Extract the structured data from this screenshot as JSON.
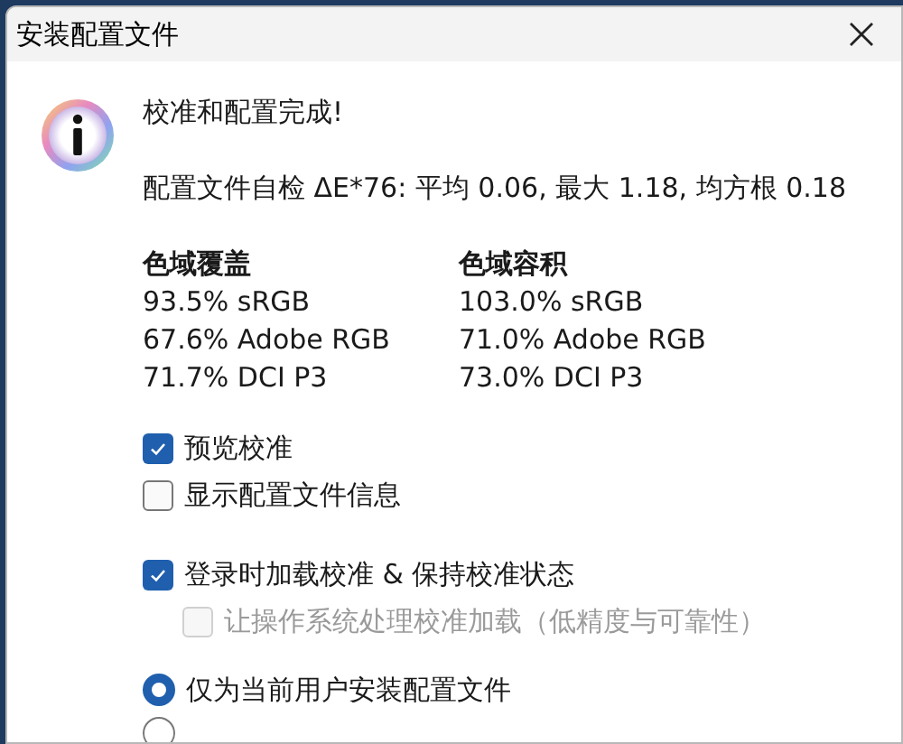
{
  "window": {
    "title": "安装配置文件"
  },
  "message": {
    "heading": "校准和配置完成!",
    "self_check": "配置文件自检 ΔE*76: 平均 0.06, 最大 1.18, 均方根 0.18"
  },
  "gamut": [
    {
      "title": "色域覆盖",
      "values": [
        "93.5% sRGB",
        "67.6% Adobe RGB",
        "71.7% DCI P3"
      ]
    },
    {
      "title": "色域容积",
      "values": [
        "103.0% sRGB",
        "71.0% Adobe RGB",
        "73.0% DCI P3"
      ]
    }
  ],
  "options": [
    {
      "label": "预览校准",
      "checked": true,
      "disabled": false
    },
    {
      "label": "显示配置文件信息",
      "checked": false,
      "disabled": false
    },
    {
      "label": "登录时加载校准 & 保持校准状态",
      "checked": true,
      "disabled": false,
      "children": [
        {
          "label": "让操作系统处理校准加载（低精度与可靠性）",
          "checked": false,
          "disabled": true
        }
      ]
    }
  ],
  "install_scope": [
    {
      "label": "仅为当前用户安装配置文件",
      "selected": true
    },
    {
      "selected": false
    }
  ]
}
